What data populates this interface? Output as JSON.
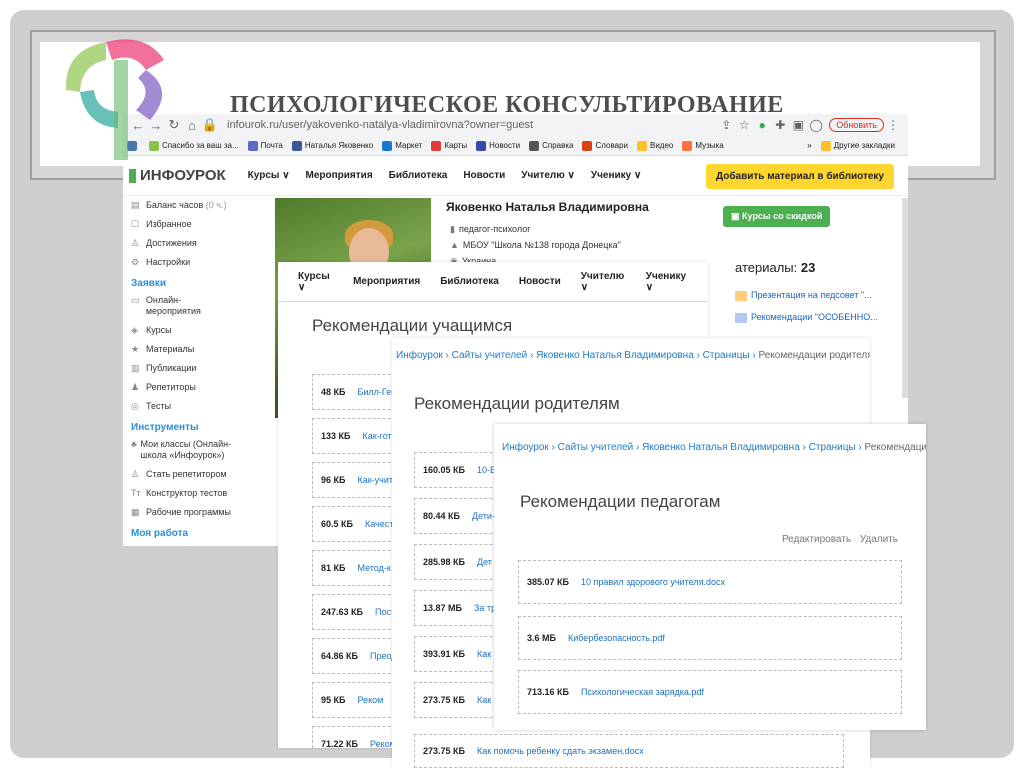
{
  "slide": {
    "title": "ПСИХОЛОГИЧЕСКОЕ КОНСУЛЬТИРОВАНИЕ"
  },
  "browser": {
    "url": "infourok.ru/user/yakovenko-natalya-vladimirovna?owner=guest",
    "update_label": "Обновить",
    "bookmarks": [
      "Спасибо за ваш за...",
      "Почта",
      "Наталья Яковенко",
      "Маркет",
      "Карты",
      "Новости",
      "Справка",
      "Словари",
      "Видео",
      "Музыка"
    ],
    "other_bookmarks": "Другие закладки"
  },
  "site": {
    "logo": "ИНФОУРОК",
    "menu": [
      "Курсы",
      "Мероприятия",
      "Библиотека",
      "Новости",
      "Учителю",
      "Ученику"
    ],
    "add_material": "Добавить материал в библиотеку"
  },
  "sidebar": {
    "balance": "Баланс часов",
    "balance_value": "(0 ч.)",
    "items_top": [
      "Избранное",
      "Достижения",
      "Настройки"
    ],
    "section_requests": "Заявки",
    "items_requests": [
      "Онлайн-мероприятия",
      "Курсы",
      "Материалы",
      "Публикации",
      "Репетиторы",
      "Тесты"
    ],
    "section_tools": "Инструменты",
    "items_tools": [
      "Мои классы (Онлайн-школа «Инфоурок»)",
      "Стать репетитором",
      "Конструктор тестов",
      "Рабочие программы"
    ],
    "section_work": "Моя работа"
  },
  "profile": {
    "name": "Яковенко Наталья Владимировна",
    "role": "педагог-психолог",
    "school": "МБОУ \"Школа №138 города Донецка\"",
    "country": "Украина",
    "discount_button": "Курсы со скидкой",
    "materials_label": "атериалы:",
    "materials_count": "23",
    "materials": [
      "Презентация на педсовет \"...",
      "Рекомендации \"ОСОБЕННО..."
    ],
    "more_suffix": "›"
  },
  "panel1": {
    "heading": "Рекомендации учащимся",
    "files": [
      {
        "size": "48 КБ",
        "name": "Билл-Гей"
      },
      {
        "size": "133 КБ",
        "name": "Как-гот"
      },
      {
        "size": "96 КБ",
        "name": "Как-учит"
      },
      {
        "size": "60.5 КБ",
        "name": "Качест"
      },
      {
        "size": "81 КБ",
        "name": "Метод-к"
      },
      {
        "size": "247.63 КБ",
        "name": "Пост"
      },
      {
        "size": "64.86 КБ",
        "name": "Преод"
      },
      {
        "size": "95 КБ",
        "name": "Реком"
      },
      {
        "size": "71.22 КБ",
        "name": "Реком"
      }
    ]
  },
  "panel2": {
    "breadcrumb": [
      "Инфоурок",
      "Сайты учителей",
      "Яковенко Наталья Владимировна",
      "Страницы"
    ],
    "breadcrumb_current": "Рекомендации родителям",
    "heading": "Рекомендации родителям",
    "files": [
      {
        "size": "160.05 КБ",
        "name": "10-В"
      },
      {
        "size": "80.44 КБ",
        "name": "Дети-"
      },
      {
        "size": "285.98 КБ",
        "name": "Дет"
      },
      {
        "size": "13.87 МБ",
        "name": "За тр"
      },
      {
        "size": "393.91 КБ",
        "name": "Как"
      },
      {
        "size": "273.75 КБ",
        "name": "Как п"
      },
      {
        "size": "273.75 КБ",
        "name": "Как помочь ребенку сдать экзамен.docx"
      }
    ]
  },
  "panel3": {
    "breadcrumb": [
      "Инфоурок",
      "Сайты учителей",
      "Яковенко Наталья Владимировна",
      "Страницы"
    ],
    "breadcrumb_current": "Рекомендации педагогам",
    "heading": "Рекомендации педагогам",
    "edit": "Редактировать",
    "delete": "Удалить",
    "files": [
      {
        "size": "385.07 КБ",
        "name": "10 правил здорового учителя.docx"
      },
      {
        "size": "3.6 МБ",
        "name": "Кибербезопасность.pdf"
      },
      {
        "size": "713.16 КБ",
        "name": "Психологическая зарядка.pdf"
      }
    ]
  },
  "colors": {
    "accent": "#2a8fd6",
    "add_button": "#ffd530",
    "green": "#4caf50",
    "link": "#1e6fc0"
  }
}
